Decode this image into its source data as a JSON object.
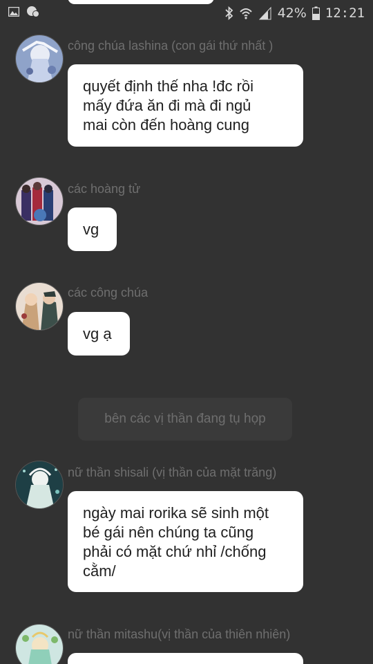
{
  "status_bar": {
    "battery_percent": "42%",
    "time": "12:21",
    "icons": [
      "gallery-icon",
      "chat-notification-icon",
      "bluetooth-icon",
      "wifi-icon",
      "signal-icon",
      "battery-icon"
    ]
  },
  "messages": [
    {
      "sender": "công chúa lashina (con gái thứ nhất )",
      "text": "quyết định thế nha !đc rồi\nmấy đứa ăn đi mà đi ngủ\nmai còn đến hoàng cung"
    },
    {
      "sender": "các hoàng tử",
      "text": "vg"
    },
    {
      "sender": "các công chúa",
      "text": "vg ạ"
    },
    {
      "sender": "nữ thần shisali (vị thần của mặt trăng)",
      "text": "ngày mai rorika sẽ sinh một\nbé gái nên chúng ta cũng\nphải có mặt chứ nhỉ /chống\ncằm/"
    },
    {
      "sender": "nữ thần mitashu(vị thần của thiên nhiên)",
      "text": ""
    }
  ],
  "narration": "bên các vị thần đang tụ họp",
  "colors": {
    "background": "#323232",
    "bubble": "#ffffff",
    "sender_text": "#6f6f6f",
    "narration_bg": "#3a3a3a"
  }
}
